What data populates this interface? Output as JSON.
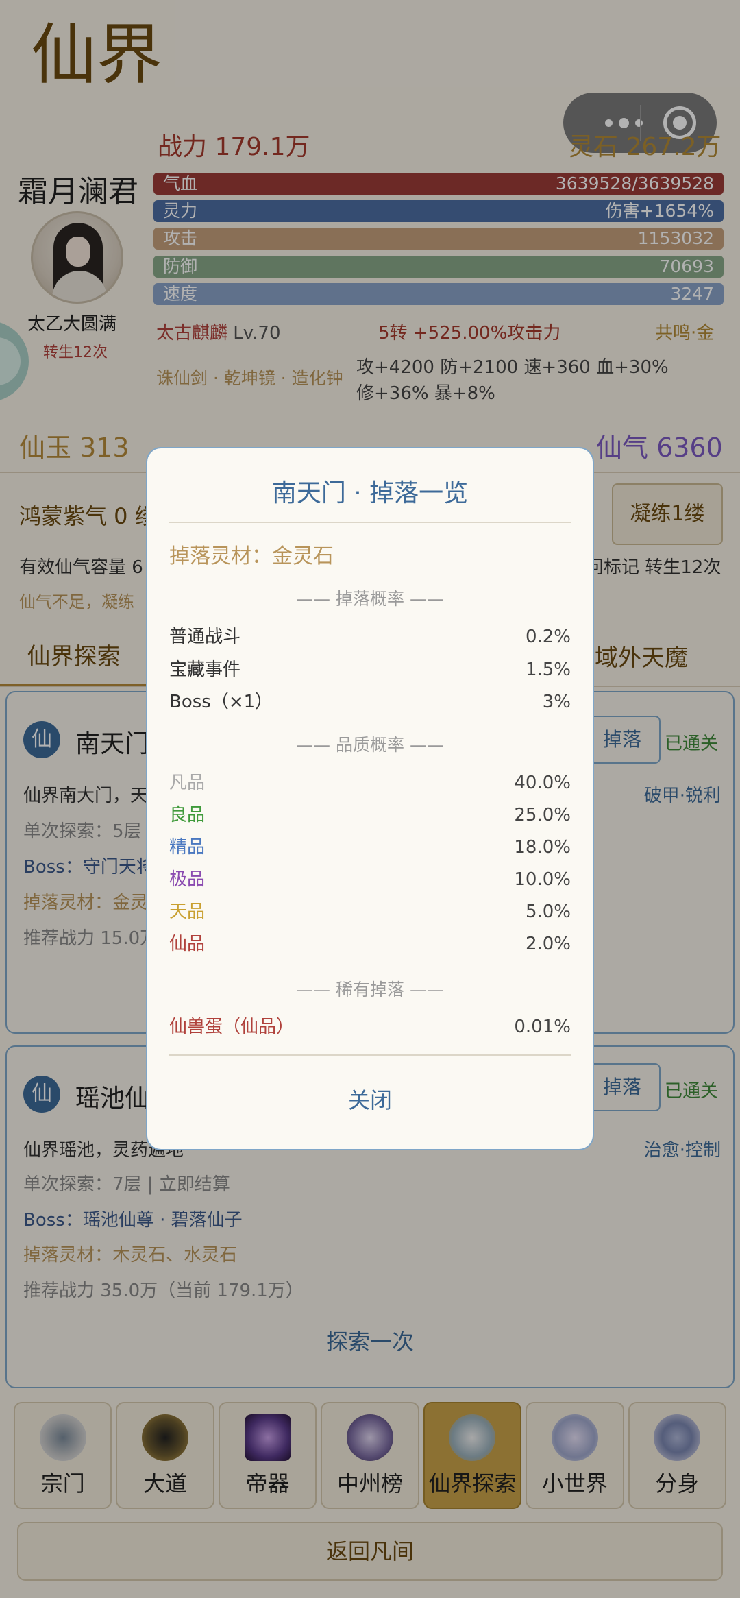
{
  "header": {
    "title": "仙界",
    "power": "战力 179.1万",
    "spirit_stone": "灵石 267.2万",
    "player_name": "霜月澜君",
    "realm": "太乙大圆满",
    "rebirth": "转生12次"
  },
  "stats": {
    "hp_label": "气血",
    "hp_value": "3639528/3639528",
    "mp_label": "灵力",
    "mp_value": "伤害+1654%",
    "atk_label": "攻击",
    "atk_value": "1153032",
    "def_label": "防御",
    "def_value": "70693",
    "spd_label": "速度",
    "spd_value": "3247"
  },
  "pet": {
    "name": "太古麒麟",
    "level": "Lv.70",
    "bonus": "5转 +525.00%攻击力",
    "resonance": "共鸣·金"
  },
  "equipment": {
    "items": "诛仙剑 · 乾坤镜 · 造化钟",
    "bonus_line1": "攻+4200 防+2100 速+360 血+30%",
    "bonus_line2": "修+36% 暴+8%"
  },
  "currency": {
    "jade": "仙玉 313",
    "qi": "仙气 6360"
  },
  "refine": {
    "hongmeng": "鸿蒙紫气 0 缕",
    "refine_button": "凝练1缕",
    "capacity": "有效仙气容量 6",
    "mark": "问标记 转生12次",
    "insufficient": "仙气不足，凝练"
  },
  "tabs": {
    "explore": "仙界探索",
    "demons": "域外天魔"
  },
  "areas": [
    {
      "badge": "仙",
      "name": "南天门",
      "drop_button": "掉落",
      "cleared": "已通关",
      "desc": "仙界南大门，天",
      "tags": "破甲·锐利",
      "single": "单次探索：5层",
      "boss": "Boss：守门天将",
      "material": "掉落灵材：金灵",
      "recommend": "推荐战力 15.0万"
    },
    {
      "badge": "仙",
      "name": "瑶池仙",
      "drop_button": "掉落",
      "cleared": "已通关",
      "desc": "仙界瑶池，灵药遍地",
      "tags": "治愈·控制",
      "single": "单次探索：7层 | 立即结算",
      "boss": "Boss：瑶池仙尊 · 碧落仙子",
      "material": "掉落灵材：木灵石、水灵石",
      "recommend": "推荐战力 35.0万（当前 179.1万）",
      "explore_button": "探索一次"
    }
  ],
  "nav": {
    "items": [
      {
        "label": "宗门",
        "icon": "sect-icon"
      },
      {
        "label": "大道",
        "icon": "dao-icon"
      },
      {
        "label": "帝器",
        "icon": "emperor-artifact-icon"
      },
      {
        "label": "中州榜",
        "icon": "ranking-icon"
      },
      {
        "label": "仙界探索",
        "icon": "immortal-explore-icon"
      },
      {
        "label": "小世界",
        "icon": "small-world-icon"
      },
      {
        "label": "分身",
        "icon": "clone-icon"
      }
    ],
    "active": "仙界探索",
    "back": "返回凡间"
  },
  "modal": {
    "title": "南天门 · 掉落一览",
    "material": "掉落灵材：金灵石",
    "section_rate": "—— 掉落概率 ——",
    "rates": [
      {
        "label": "普通战斗",
        "value": "0.2%"
      },
      {
        "label": "宝藏事件",
        "value": "1.5%"
      },
      {
        "label": "Boss（×1）",
        "value": "3%"
      }
    ],
    "section_quality": "—— 品质概率 ——",
    "qualities": [
      {
        "label": "凡品",
        "value": "40.0%",
        "color": "#a8a8a8"
      },
      {
        "label": "良品",
        "value": "25.0%",
        "color": "#3f9a3a"
      },
      {
        "label": "精品",
        "value": "18.0%",
        "color": "#4a78c0"
      },
      {
        "label": "极品",
        "value": "10.0%",
        "color": "#8a4ab0"
      },
      {
        "label": "天品",
        "value": "5.0%",
        "color": "#c9a030"
      },
      {
        "label": "仙品",
        "value": "2.0%",
        "color": "#b0413b"
      }
    ],
    "section_rare": "—— 稀有掉落 ——",
    "rare": [
      {
        "label": "仙兽蛋（仙品）",
        "value": "0.01%"
      }
    ],
    "close": "关闭"
  }
}
